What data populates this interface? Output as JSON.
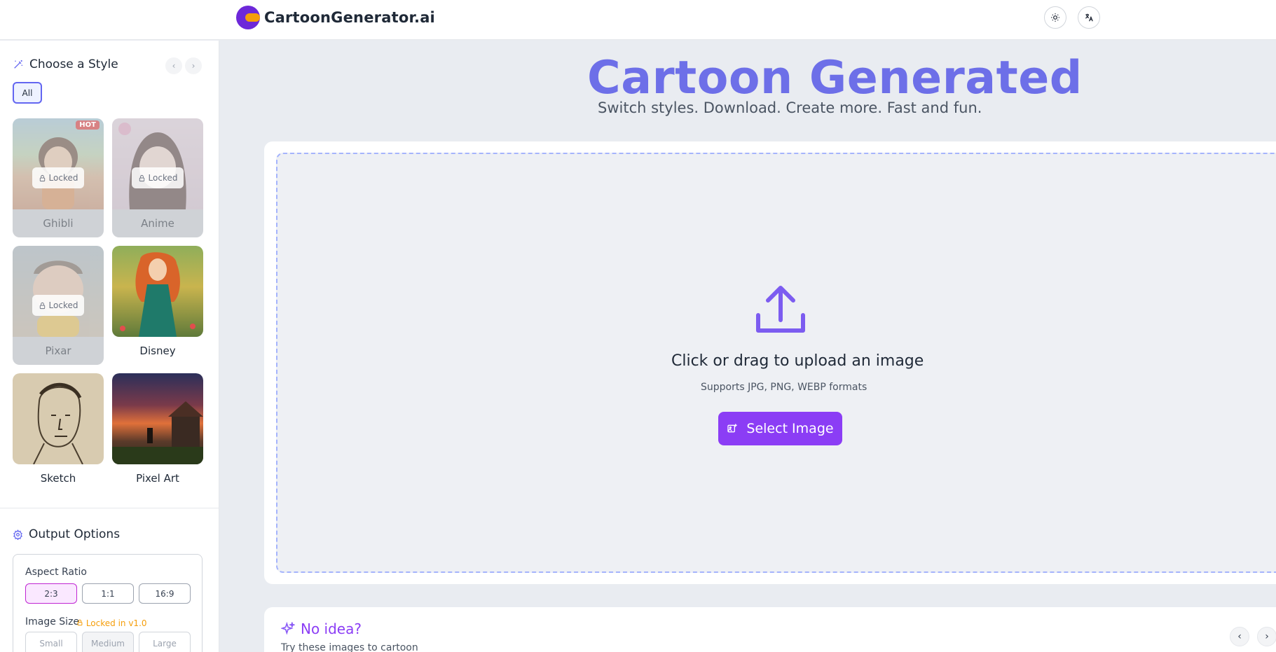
{
  "header": {
    "brand": "CartoonGenerator.ai",
    "theme_icon": "sun-icon",
    "lang_icon": "translate-icon"
  },
  "sidebar": {
    "styles_title": "Choose a Style",
    "filter_all": "All",
    "styles": [
      {
        "label": "Ghibli",
        "locked": true,
        "locked_text": "Locked",
        "badge": "HOT"
      },
      {
        "label": "Anime",
        "locked": true,
        "locked_text": "Locked"
      },
      {
        "label": "Pixar",
        "locked": true,
        "locked_text": "Locked"
      },
      {
        "label": "Disney",
        "locked": false
      },
      {
        "label": "Sketch",
        "locked": false
      },
      {
        "label": "Pixel Art",
        "locked": false
      }
    ],
    "options_title": "Output Options",
    "aspect_ratio_label": "Aspect Ratio",
    "aspect_ratios": [
      "2:3",
      "1:1",
      "16:9"
    ],
    "aspect_selected": "2:3",
    "image_size_label": "Image Size",
    "image_size_locked_note": "Locked in v1.0",
    "image_sizes": [
      "Small",
      "Medium",
      "Large"
    ],
    "size_selected": "Medium"
  },
  "main": {
    "title": "Cartoon Generated",
    "subtitle": "Switch styles. Download. Create more. Fast and fun.",
    "upload_title": "Click or drag to upload an image",
    "upload_sub": "Supports JPG, PNG, WEBP formats",
    "select_button": "Select Image",
    "idea_title": "No idea?",
    "idea_sub": "Try these images to cartoon"
  },
  "colors": {
    "accent": "#6366f1",
    "primary_button": "#8b3df5",
    "title": "#6d6fe8",
    "locked_warning": "#f59e0b"
  }
}
